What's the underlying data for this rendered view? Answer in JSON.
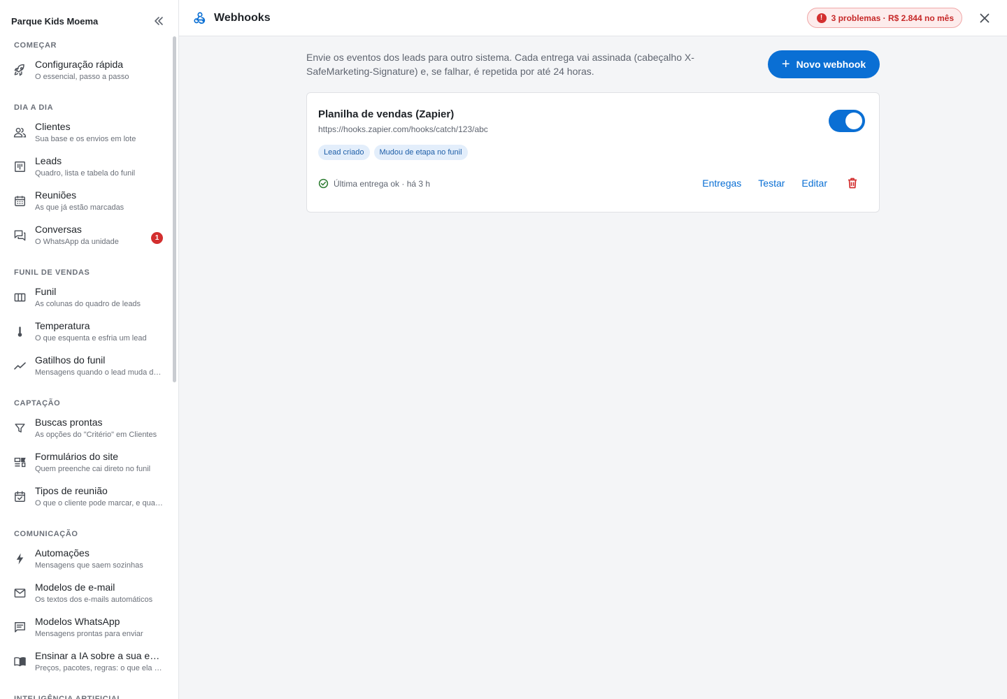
{
  "sidebar": {
    "org_name": "Parque Kids Moema",
    "sections": [
      {
        "label": "COMEÇAR",
        "items": [
          {
            "label": "Configuração rápida",
            "sub": "O essencial, passo a passo",
            "icon": "rocket-icon"
          }
        ]
      },
      {
        "label": "DIA A DIA",
        "items": [
          {
            "label": "Clientes",
            "sub": "Sua base e os envios em lote",
            "icon": "people-icon"
          },
          {
            "label": "Leads",
            "sub": "Quadro, lista e tabela do funil",
            "icon": "kanban-icon"
          },
          {
            "label": "Reuniões",
            "sub": "As que já estão marcadas",
            "icon": "calendar-icon"
          },
          {
            "label": "Conversas",
            "sub": "O WhatsApp da unidade",
            "icon": "chat-icon",
            "badge": "1"
          }
        ]
      },
      {
        "label": "FUNIL DE VENDAS",
        "items": [
          {
            "label": "Funil",
            "sub": "As colunas do quadro de leads",
            "icon": "columns-icon"
          },
          {
            "label": "Temperatura",
            "sub": "O que esquenta e esfria um lead",
            "icon": "thermometer-icon"
          },
          {
            "label": "Gatilhos do funil",
            "sub": "Mensagens quando o lead muda de etapa",
            "icon": "trend-icon"
          }
        ]
      },
      {
        "label": "CAPTAÇÃO",
        "items": [
          {
            "label": "Buscas prontas",
            "sub": "As opções do \"Critério\" em Clientes",
            "icon": "filter-icon"
          },
          {
            "label": "Formulários do site",
            "sub": "Quem preenche cai direto no funil",
            "icon": "form-icon"
          },
          {
            "label": "Tipos de reunião",
            "sub": "O que o cliente pode marcar, e quando",
            "icon": "event-check-icon"
          }
        ]
      },
      {
        "label": "COMUNICAÇÃO",
        "items": [
          {
            "label": "Automações",
            "sub": "Mensagens que saem sozinhas",
            "icon": "bolt-icon"
          },
          {
            "label": "Modelos de e-mail",
            "sub": "Os textos dos e-mails automáticos",
            "icon": "mail-icon"
          },
          {
            "label": "Modelos WhatsApp",
            "sub": "Mensagens prontas para enviar",
            "icon": "message-icon"
          },
          {
            "label": "Ensinar a IA sobre a sua empresa",
            "sub": "Preços, pacotes, regras: o que ela precisa saber",
            "icon": "book-icon"
          }
        ]
      },
      {
        "label": "INTELIGÊNCIA ARTIFICIAL",
        "items": []
      }
    ]
  },
  "header": {
    "title": "Webhooks",
    "icon": "webhook-icon",
    "problems": "3 problemas · R$ 2.844 no mês",
    "problems_icon": "!"
  },
  "main": {
    "intro": "Envie os eventos dos leads para outro sistema. Cada entrega vai assinada (cabeçalho X-SafeMarketing-Signature) e, se falhar, é repetida por até 24 horas.",
    "new_button": "Novo webhook",
    "new_button_icon": "+",
    "webhooks": [
      {
        "name": "Planilha de vendas (Zapier)",
        "url": "https://hooks.zapier.com/hooks/catch/123/abc",
        "enabled": true,
        "events": [
          "Lead criado",
          "Mudou de etapa no funil"
        ],
        "status": "Última entrega ok · há 3 h",
        "actions": {
          "deliveries": "Entregas",
          "test": "Testar",
          "edit": "Editar"
        }
      }
    ]
  },
  "colors": {
    "accent": "#0a6fd4",
    "danger": "#d32f2f",
    "success": "#2e7d32"
  }
}
